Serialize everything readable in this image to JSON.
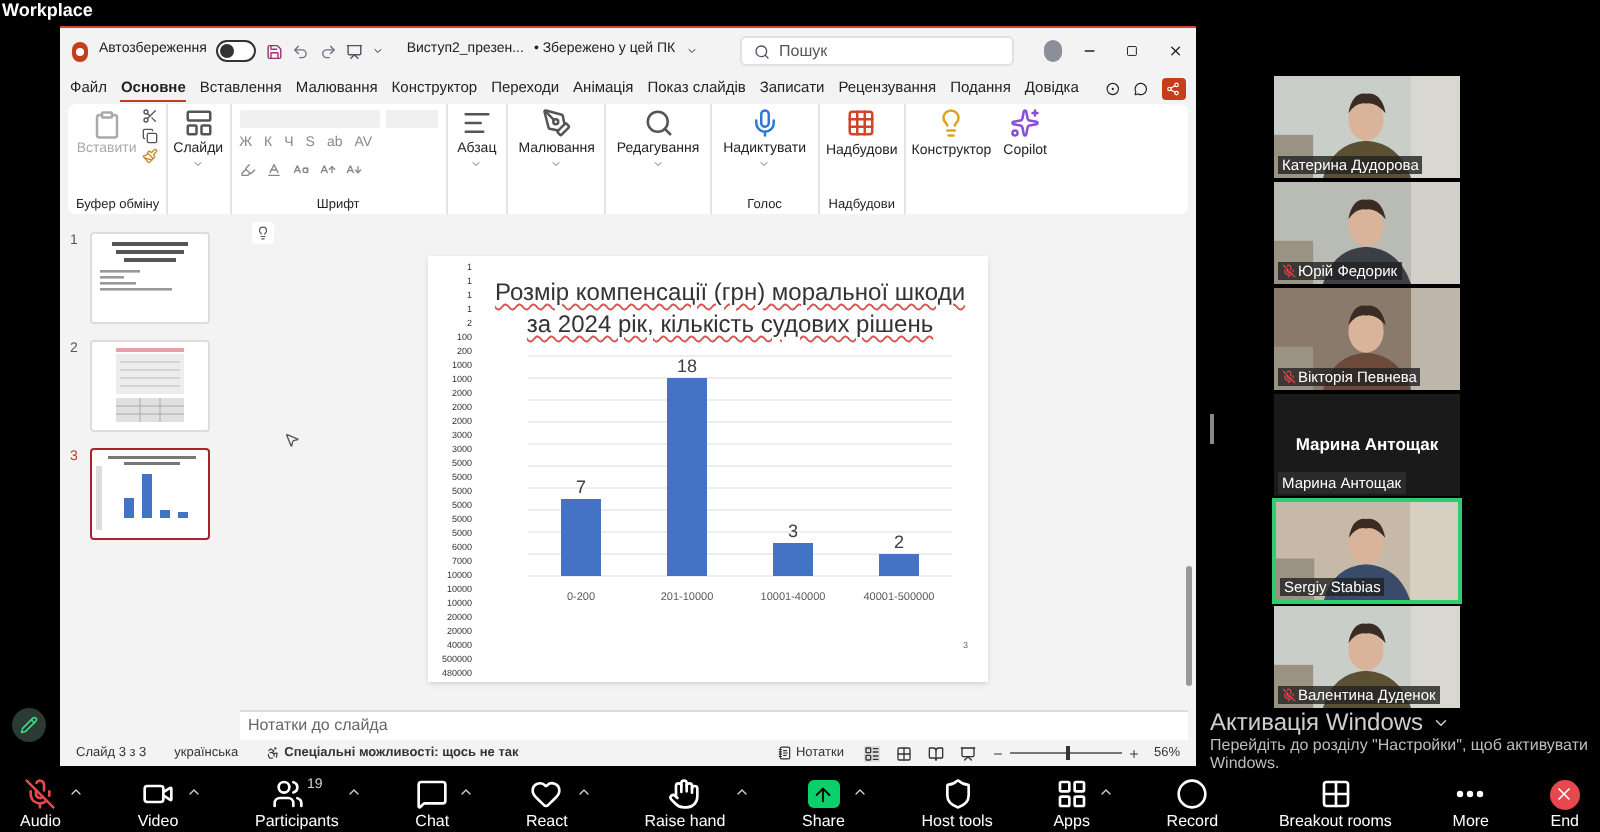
{
  "app_header": {
    "title": "Workplace"
  },
  "powerpoint": {
    "autosave": {
      "label": "Автозбереження",
      "on": false
    },
    "file_name": "Виступ2_презен...",
    "save_status": "• Збережено у цей ПК",
    "search": {
      "placeholder": "Пошук"
    },
    "menu_tabs": [
      {
        "label": "Файл",
        "selected": false
      },
      {
        "label": "Основне",
        "selected": true
      },
      {
        "label": "Вставлення",
        "selected": false
      },
      {
        "label": "Малювання",
        "selected": false
      },
      {
        "label": "Конструктор",
        "selected": false
      },
      {
        "label": "Переходи",
        "selected": false
      },
      {
        "label": "Анімація",
        "selected": false
      },
      {
        "label": "Показ слайдів",
        "selected": false
      },
      {
        "label": "Записати",
        "selected": false
      },
      {
        "label": "Рецензування",
        "selected": false
      },
      {
        "label": "Подання",
        "selected": false
      },
      {
        "label": "Довідка",
        "selected": false
      }
    ],
    "clipboard": {
      "paste_label": "Вставити",
      "paste_disabled": true,
      "group_label": "Буфер обміну"
    },
    "slides_button": "Слайди",
    "font": {
      "group_label": "Шрифт",
      "format_buttons": [
        "Ж",
        "К",
        "Ч",
        "S",
        "ab",
        "AV"
      ]
    },
    "ribbon_buttons": [
      {
        "label": "Абзац",
        "kind": "paragraph"
      },
      {
        "label": "Малювання",
        "kind": "draw"
      },
      {
        "label": "Редагування",
        "kind": "edit"
      }
    ],
    "voice": {
      "button": "Надиктувати",
      "group_label": "Голос"
    },
    "addins": {
      "button": "Надбудови",
      "group_label": "Надбудови"
    },
    "extra_buttons": [
      {
        "label": "Конструктор",
        "kind": "designer"
      },
      {
        "label": "Copilot",
        "kind": "copilot"
      }
    ],
    "thumbnails": [
      {
        "number": "1",
        "selected": false,
        "kind": "text"
      },
      {
        "number": "2",
        "selected": false,
        "kind": "table"
      },
      {
        "number": "3",
        "selected": true,
        "kind": "chart"
      }
    ],
    "slide": {
      "side_numbers": [
        "1",
        "1",
        "1",
        "1",
        "2",
        "100",
        "200",
        "1000",
        "1000",
        "2000",
        "2000",
        "2000",
        "3000",
        "3000",
        "5000",
        "5000",
        "5000",
        "5000",
        "5000",
        "5000",
        "6000",
        "7000",
        "10000",
        "10000",
        "10000",
        "20000",
        "20000",
        "40000",
        "500000",
        "480000"
      ],
      "chart_data": {
        "type": "bar",
        "title": "Розмір компенсації (грн) моральної шкоди за 2024 рік, кількість судових рішень",
        "categories": [
          "0-200",
          "201-10000",
          "10001-40000",
          "40001-500000"
        ],
        "values": [
          7,
          18,
          3,
          2
        ],
        "ylim": [
          0,
          20
        ],
        "data_labels": true
      },
      "page_number": "3"
    },
    "notes_placeholder": "Нотатки до слайда",
    "status": {
      "slide_counter": "Слайд 3 з 3",
      "language": "українська",
      "accessibility": "Спеціальні можливості: щось не так",
      "notes_button": "Нотатки",
      "level": 0.5,
      "zoom": "56%"
    }
  },
  "participants": [
    {
      "name": "Катерина Дудорова",
      "muted": false,
      "kind": "video",
      "active_speaker": false
    },
    {
      "name": "Юрій Федорик",
      "muted": true,
      "kind": "video",
      "active_speaker": false
    },
    {
      "name": "Вікторія Певнева",
      "muted": true,
      "kind": "video",
      "active_speaker": false
    },
    {
      "title": "Марина Антощак",
      "name": "Марина Антощак",
      "muted": false,
      "kind": "name_only",
      "active_speaker": false
    },
    {
      "name": "Sergiy Stabias",
      "muted": false,
      "kind": "video",
      "active_speaker": true
    },
    {
      "name": "Валентина Дуденок",
      "muted": true,
      "kind": "video",
      "active_speaker": false
    }
  ],
  "windows_activation": {
    "title": "Активація Windows",
    "message": "Перейдіть до розділу \"Настройки\", щоб активувати Windows."
  },
  "toolbar": [
    {
      "label": "Audio",
      "kind": "audio",
      "muted": true,
      "has_menu": true
    },
    {
      "label": "Video",
      "kind": "video",
      "has_menu": true
    },
    {
      "label": "Participants",
      "kind": "participants",
      "count": "19",
      "has_menu": true
    },
    {
      "label": "Chat",
      "kind": "chat",
      "has_menu": true
    },
    {
      "label": "React",
      "kind": "react",
      "has_menu": true
    },
    {
      "label": "Raise hand",
      "kind": "raise_hand",
      "has_menu": true
    },
    {
      "label": "Share",
      "kind": "share",
      "has_menu": true
    },
    {
      "label": "Host tools",
      "kind": "host_tools",
      "has_menu": false
    },
    {
      "label": "Apps",
      "kind": "apps",
      "has_menu": true
    },
    {
      "label": "Record",
      "kind": "record",
      "has_menu": false
    },
    {
      "label": "Breakout rooms",
      "kind": "breakout",
      "has_menu": false
    },
    {
      "label": "More",
      "kind": "more",
      "has_menu": false
    },
    {
      "label": "End",
      "kind": "end",
      "has_menu": false
    }
  ]
}
